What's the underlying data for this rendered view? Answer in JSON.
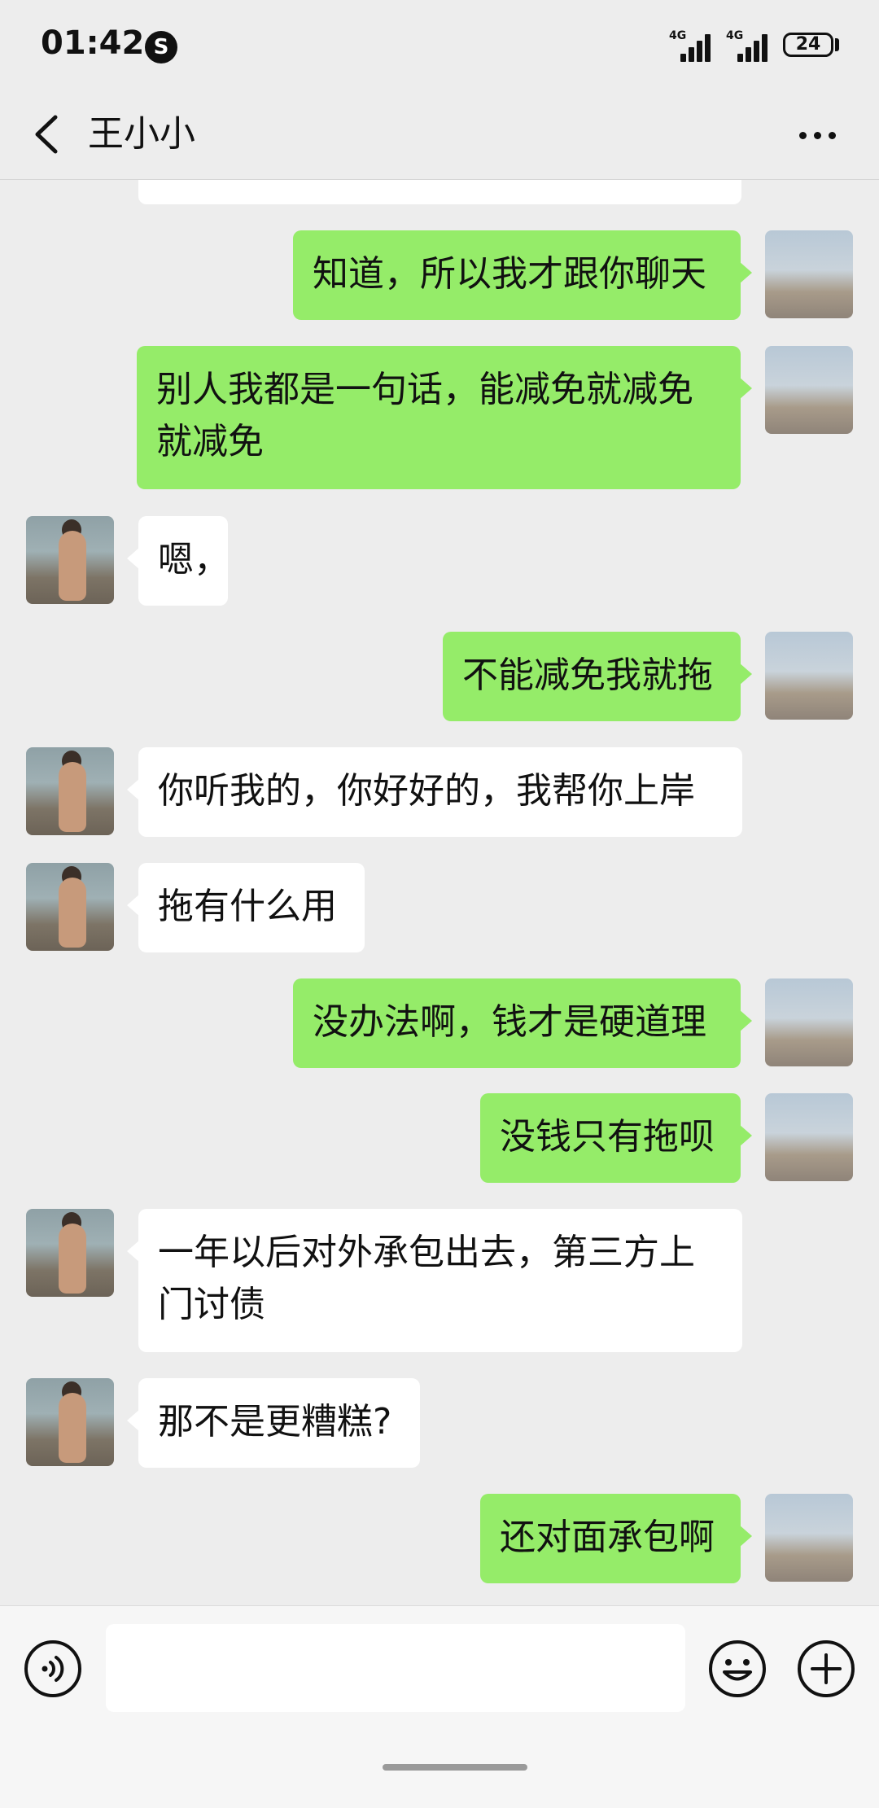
{
  "status_bar": {
    "time": "01:42",
    "app_icon": "S",
    "signal1_label": "4G",
    "signal2_label": "4G",
    "battery": "24"
  },
  "header": {
    "title": "王小小",
    "back_icon": "chevron-left-icon",
    "more_icon": "more-dots-icon"
  },
  "messages": [
    {
      "from": "other",
      "text": ""
    },
    {
      "from": "me",
      "text": "知道，所以我才跟你聊天"
    },
    {
      "from": "me",
      "text": "别人我都是一句话，能减免就减免就减免"
    },
    {
      "from": "other",
      "text": "嗯，"
    },
    {
      "from": "me",
      "text": "不能减免我就拖"
    },
    {
      "from": "other",
      "text": "你听我的，你好好的，我帮你上岸"
    },
    {
      "from": "other",
      "text": "拖有什么用"
    },
    {
      "from": "me",
      "text": "没办法啊，钱才是硬道理"
    },
    {
      "from": "me",
      "text": "没钱只有拖呗"
    },
    {
      "from": "other",
      "text": "一年以后对外承包出去，第三方上门讨债"
    },
    {
      "from": "other",
      "text": "那不是更糟糕?"
    },
    {
      "from": "me",
      "text": "还对面承包啊"
    }
  ],
  "input_bar": {
    "placeholder": "",
    "voice_icon": "voice-icon",
    "emoji_icon": "emoji-icon",
    "plus_icon": "plus-icon"
  },
  "colors": {
    "me_bubble": "#95ec69",
    "other_bubble": "#ffffff",
    "background": "#ededed"
  }
}
